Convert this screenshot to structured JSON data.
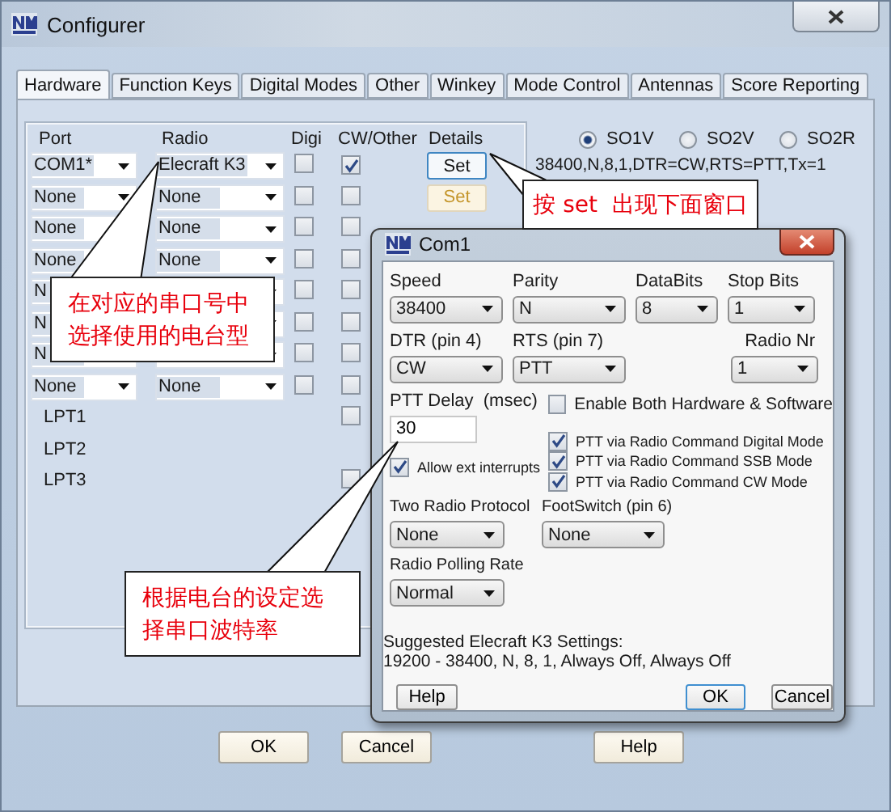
{
  "window": {
    "title": "Configurer"
  },
  "tabs": [
    {
      "label": "Hardware",
      "selected": true
    },
    {
      "label": "Function Keys",
      "selected": false
    },
    {
      "label": "Digital Modes",
      "selected": false
    },
    {
      "label": "Other",
      "selected": false
    },
    {
      "label": "Winkey",
      "selected": false
    },
    {
      "label": "Mode Control",
      "selected": false
    },
    {
      "label": "Antennas",
      "selected": false
    },
    {
      "label": "Score Reporting",
      "selected": false
    }
  ],
  "hardware": {
    "columns": [
      "Port",
      "Radio",
      "Digi",
      "CW/Other",
      "Details"
    ],
    "rows": [
      {
        "kind": "com",
        "port": "COM1*",
        "radio": "Elecraft K3",
        "digi": false,
        "cw": true,
        "details": {
          "label": "Set",
          "enabled": true
        }
      },
      {
        "kind": "com",
        "port": "None",
        "radio": "None",
        "digi": false,
        "cw": false,
        "details": {
          "label": "Set",
          "enabled": false
        }
      },
      {
        "kind": "com",
        "port": "None",
        "radio": "None",
        "digi": false,
        "cw": false
      },
      {
        "kind": "com",
        "port": "None",
        "radio": "None",
        "digi": false,
        "cw": false
      },
      {
        "kind": "com",
        "port": "N",
        "digi": false,
        "cw": false
      },
      {
        "kind": "com",
        "port": "N",
        "digi": false,
        "cw": false
      },
      {
        "kind": "com",
        "port": "N",
        "digi": false,
        "cw": false
      },
      {
        "kind": "com",
        "port": "None",
        "radio": "None",
        "digi": false,
        "cw": false
      },
      {
        "kind": "lpt",
        "port": "LPT1",
        "cw": false
      },
      {
        "kind": "lpt",
        "port": "LPT2"
      },
      {
        "kind": "lpt",
        "port": "LPT3",
        "cw": false
      }
    ],
    "operation_modes": [
      {
        "label": "SO1V",
        "selected": true
      },
      {
        "label": "SO2V",
        "selected": false
      },
      {
        "label": "SO2R",
        "selected": false
      }
    ],
    "summary": "38400,N,8,1,DTR=CW,RTS=PTT,Tx=1"
  },
  "buttons": [
    "OK",
    "Cancel",
    "Help"
  ],
  "dialog": {
    "title": "Com1",
    "row1": [
      {
        "label": "Speed",
        "value": "38400"
      },
      {
        "label": "Parity",
        "value": "N"
      },
      {
        "label": "DataBits",
        "value": "8"
      },
      {
        "label": "Stop Bits",
        "value": "1"
      }
    ],
    "row2": [
      {
        "label": "DTR (pin 4)",
        "value": "CW"
      },
      {
        "label": "RTS (pin 7)",
        "value": "PTT"
      },
      {
        "label": "Radio Nr",
        "value": "1"
      }
    ],
    "ptt_delay": {
      "label": "PTT Delay  (msec)",
      "value": "30"
    },
    "allow_ext_interrupts": {
      "label": "Allow ext interrupts",
      "checked": true
    },
    "options": [
      {
        "label": "Enable Both Hardware & Software",
        "checked": false
      },
      {
        "label": "PTT via Radio Command Digital Mode",
        "checked": true
      },
      {
        "label": "PTT via Radio Command SSB Mode",
        "checked": true
      },
      {
        "label": "PTT via Radio Command CW Mode",
        "checked": true
      }
    ],
    "row3": [
      {
        "label": "Two Radio Protocol",
        "value": "None"
      },
      {
        "label": "FootSwitch (pin 6)",
        "value": "None"
      }
    ],
    "polling": {
      "label": "Radio Polling Rate",
      "value": "Normal"
    },
    "suggested": [
      "Suggested Elecraft K3 Settings:",
      "19200 - 38400, N, 8, 1, Always Off, Always Off"
    ],
    "buttons": [
      {
        "label": "Help",
        "default": false
      },
      {
        "label": "OK",
        "default": true
      },
      {
        "label": "Cancel",
        "default": false
      }
    ]
  },
  "callouts": [
    "在对应的串口号中选择使用的电台型",
    "按 set  出现下面窗口",
    "根据电台的设定选择串口波特率"
  ]
}
